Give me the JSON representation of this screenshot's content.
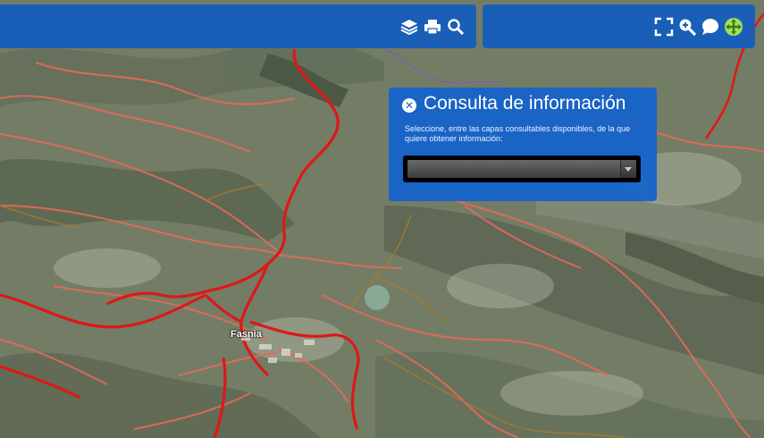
{
  "colors": {
    "toolbar_bg": "#125cbe",
    "panel_bg": "#1262cd",
    "main_road": "#dd1818",
    "secondary_road": "#e9685a",
    "track": "#a8792e",
    "pan_icon": "#9fe05a"
  },
  "toolbar": {
    "left_icons": [
      "layers-icon",
      "print-icon",
      "search-icon"
    ],
    "right_icons": [
      "fullscreen-icon",
      "zoom-in-icon",
      "info-bubble-icon",
      "pan-icon"
    ]
  },
  "panel": {
    "close_glyph": "✕",
    "title": "Consulta de información",
    "description": "Seleccione, entre las capas consultables disponibles, de la que quiere obtener información:",
    "select_value": ""
  },
  "map": {
    "place_label": "Fasnia"
  }
}
